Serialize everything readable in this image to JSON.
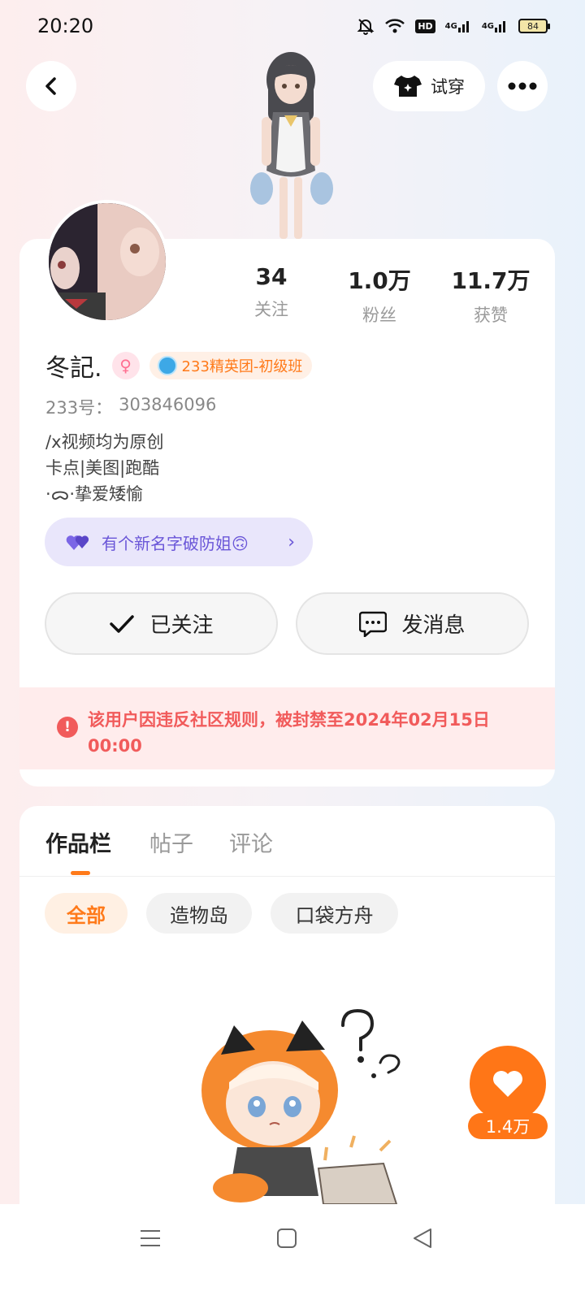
{
  "status_bar": {
    "time": "20:20",
    "hd_label": "HD",
    "signal_1": "4G",
    "signal_2": "4G",
    "battery": "84"
  },
  "header": {
    "back_icon": "chevron-left-icon",
    "try_on_label": "试穿",
    "try_on_icon": "tshirt-sparkle-icon",
    "more_icon": "more-dots-icon"
  },
  "profile": {
    "stats": [
      {
        "value": "34",
        "label": "关注"
      },
      {
        "value": "1.0万",
        "label": "粉丝"
      },
      {
        "value": "11.7万",
        "label": "获赞"
      }
    ],
    "username": "冬記.",
    "gender_icon": "female-symbol-icon",
    "rank_badge": "233精英团-初级班",
    "uid_label": "233号：",
    "uid_value": "303846096",
    "bio_lines": [
      "/x视频均为原创",
      "卡点|美图|跑酷",
      "·ᯅ·挚爱矮愉"
    ],
    "group_name": "有个新名字破防姐🙃",
    "follow_label": "已关注",
    "message_label": "发消息",
    "ban_notice": "该用户因违反社区规则，被封禁至2024年02月15日 00:00"
  },
  "tabs": [
    {
      "label": "作品栏",
      "active": true
    },
    {
      "label": "帖子",
      "active": false
    },
    {
      "label": "评论",
      "active": false
    }
  ],
  "filters": [
    {
      "label": "全部",
      "active": true
    },
    {
      "label": "造物岛",
      "active": false
    },
    {
      "label": "口袋方舟",
      "active": false
    }
  ],
  "like_fab": {
    "count": "1.4万",
    "icon": "heart-icon"
  },
  "colors": {
    "accent": "#ff7617",
    "ban_red": "#f15b5b",
    "group_purple": "#6a56d8"
  }
}
